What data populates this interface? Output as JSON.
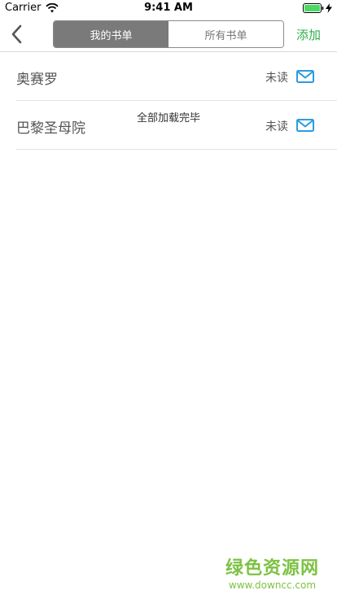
{
  "status_bar": {
    "carrier": "Carrier",
    "time": "9:41 AM"
  },
  "nav": {
    "back_icon": "chevron-left-icon",
    "segments": [
      {
        "label": "我的书单",
        "active": true
      },
      {
        "label": "所有书单",
        "active": false
      }
    ],
    "add_label": "添加"
  },
  "list": {
    "items": [
      {
        "title": "奥赛罗",
        "status": "未读",
        "icon": "mail-icon"
      },
      {
        "title": "巴黎圣母院",
        "status": "未读",
        "icon": "mail-icon"
      }
    ],
    "footer": "全部加载完毕"
  },
  "watermark": {
    "name": "绿色资源网",
    "url": "www.downcc.com"
  },
  "colors": {
    "accent_green": "#2fae4f",
    "mail_blue": "#2d9be0",
    "segment_active": "#7a7a7a",
    "watermark_green": "#7dc243"
  }
}
